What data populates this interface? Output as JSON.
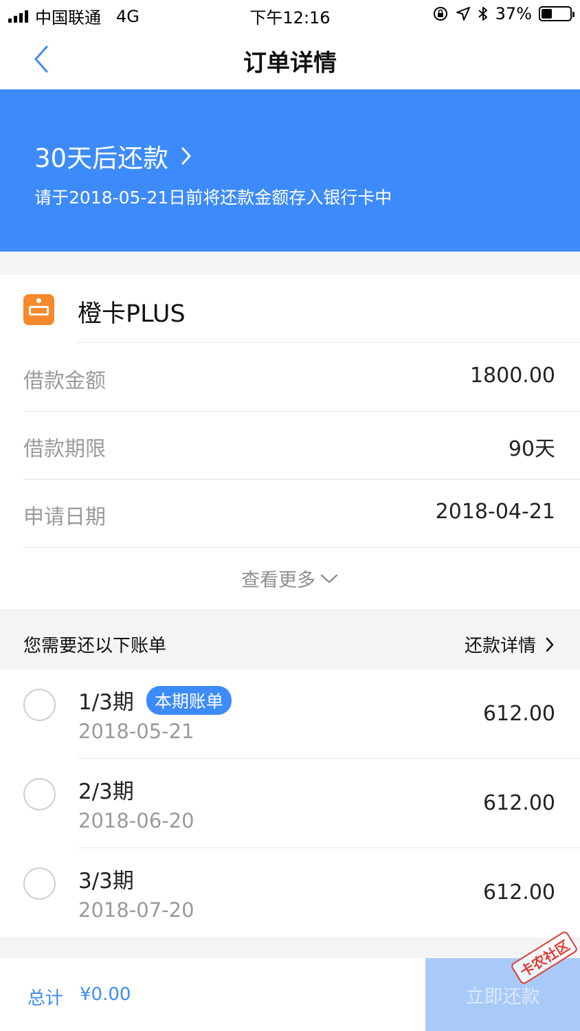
{
  "status_bar": {
    "carrier": "中国联通",
    "network": "4G",
    "time": "下午12:16",
    "battery": "37%",
    "battery_level": 0.37
  },
  "nav": {
    "title": "订单详情"
  },
  "banner": {
    "title": "30天后还款",
    "subtitle": "请于2018-05-21日前将还款金额存入银行卡中",
    "color": "#3d8bfb"
  },
  "product": {
    "name": "橙卡PLUS",
    "icon": "card-icon",
    "icon_color": "#f5892c"
  },
  "details": [
    {
      "label": "借款金额",
      "value": "1800.00"
    },
    {
      "label": "借款期限",
      "value": "90天"
    },
    {
      "label": "申请日期",
      "value": "2018-04-21"
    }
  ],
  "more_label": "查看更多",
  "bills": {
    "title": "您需要还以下账单",
    "detail_link": "还款详情",
    "current_badge": "本期账单",
    "items": [
      {
        "period": "1/3期",
        "date": "2018-05-21",
        "amount": "612.00"
      },
      {
        "period": "2/3期",
        "date": "2018-06-20",
        "amount": "612.00"
      },
      {
        "period": "3/3期",
        "date": "2018-07-20",
        "amount": "612.00"
      }
    ]
  },
  "bottom": {
    "total_label": "总计",
    "total_value": "¥0.00",
    "pay_label": "立即还款"
  },
  "watermark": "卡农社区"
}
